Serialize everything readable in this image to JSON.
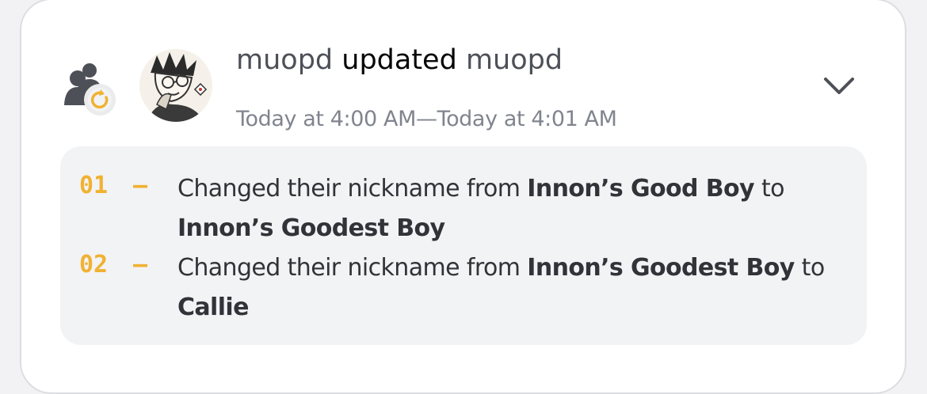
{
  "entry": {
    "actor": "muopd",
    "verb": "updated",
    "target": "muopd",
    "timestamp": "Today at 4:00 AM—Today at 4:01 AM",
    "type_icon": "members-update-icon",
    "avatar": "user-avatar-drawing",
    "expand_icon": "chevron-down-icon",
    "accent_color": "#f0b232"
  },
  "changes": [
    {
      "index": "01",
      "dash": "—",
      "prefix": "Changed their nickname from ",
      "from": "Innon’s Good Boy",
      "joiner": " to ",
      "to": "Innon’s Goodest Boy"
    },
    {
      "index": "02",
      "dash": "—",
      "prefix": "Changed their nickname from ",
      "from": "Innon’s Goodest Boy",
      "joiner": " to ",
      "to": "Callie"
    }
  ]
}
